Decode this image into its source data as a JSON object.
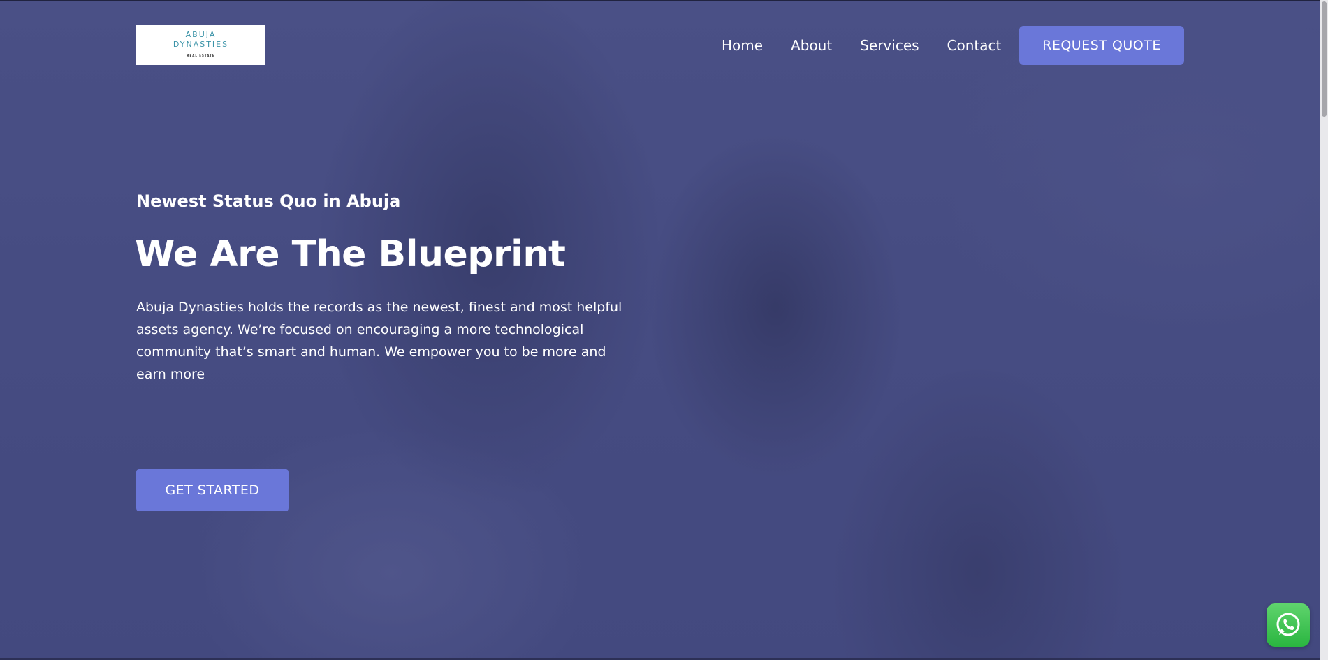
{
  "brand": {
    "logo_line1": "ABUJA",
    "logo_line2": "DYNASTIES",
    "logo_tagline": "REAL ESTATE"
  },
  "nav": {
    "items": [
      {
        "label": "Home"
      },
      {
        "label": "About"
      },
      {
        "label": "Services"
      },
      {
        "label": "Contact"
      }
    ],
    "cta_label": "REQUEST QUOTE"
  },
  "hero": {
    "eyebrow": "Newest Status Quo in Abuja",
    "title": "We Are The Blueprint",
    "description": "Abuja Dynasties holds the records as the newest, finest and most helpful assets agency. We’re focused on encouraging a more technological community that’s smart and human. We empower you to be more and earn more",
    "cta_label": "GET STARTED"
  },
  "widgets": {
    "chat_icon": "whatsapp-icon"
  },
  "colors": {
    "accent": "#6a77d9",
    "overlay": "#4b5182",
    "whatsapp": "#2ab540"
  }
}
